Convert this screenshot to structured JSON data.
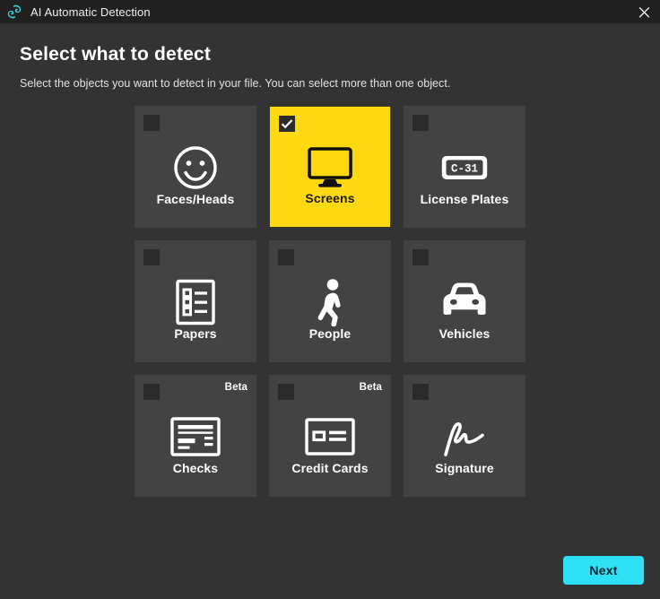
{
  "titlebar": {
    "title": "AI Automatic Detection",
    "logo_icon": "swirl-logo-icon",
    "logo_color": "#32d8e0",
    "close_icon": "close-icon",
    "background": "#212121"
  },
  "header": {
    "title": "Select what to detect",
    "subtitle": "Select the objects you want to detect in your file. You can select more than one object."
  },
  "theme": {
    "page_background": "#333333",
    "card_background": "#434343",
    "selected_card_background": "#ffd814",
    "accent_button": "#2ee0f5",
    "text": "#ffffff"
  },
  "cards": [
    {
      "label": "Faces/Heads",
      "icon": "smiley-face-icon",
      "selected": false,
      "beta": ""
    },
    {
      "label": "Screens",
      "icon": "monitor-icon",
      "selected": true,
      "beta": ""
    },
    {
      "label": "License Plates",
      "icon": "license-plate-icon",
      "selected": false,
      "beta": "",
      "plate_text": "C-31"
    },
    {
      "label": "Papers",
      "icon": "document-list-icon",
      "selected": false,
      "beta": ""
    },
    {
      "label": "People",
      "icon": "pedestrian-icon",
      "selected": false,
      "beta": ""
    },
    {
      "label": "Vehicles",
      "icon": "car-icon",
      "selected": false,
      "beta": ""
    },
    {
      "label": "Checks",
      "icon": "check-slip-icon",
      "selected": false,
      "beta": "Beta"
    },
    {
      "label": "Credit Cards",
      "icon": "credit-card-icon",
      "selected": false,
      "beta": "Beta"
    },
    {
      "label": "Signature",
      "icon": "signature-icon",
      "selected": false,
      "beta": ""
    }
  ],
  "footer": {
    "next_label": "Next"
  }
}
